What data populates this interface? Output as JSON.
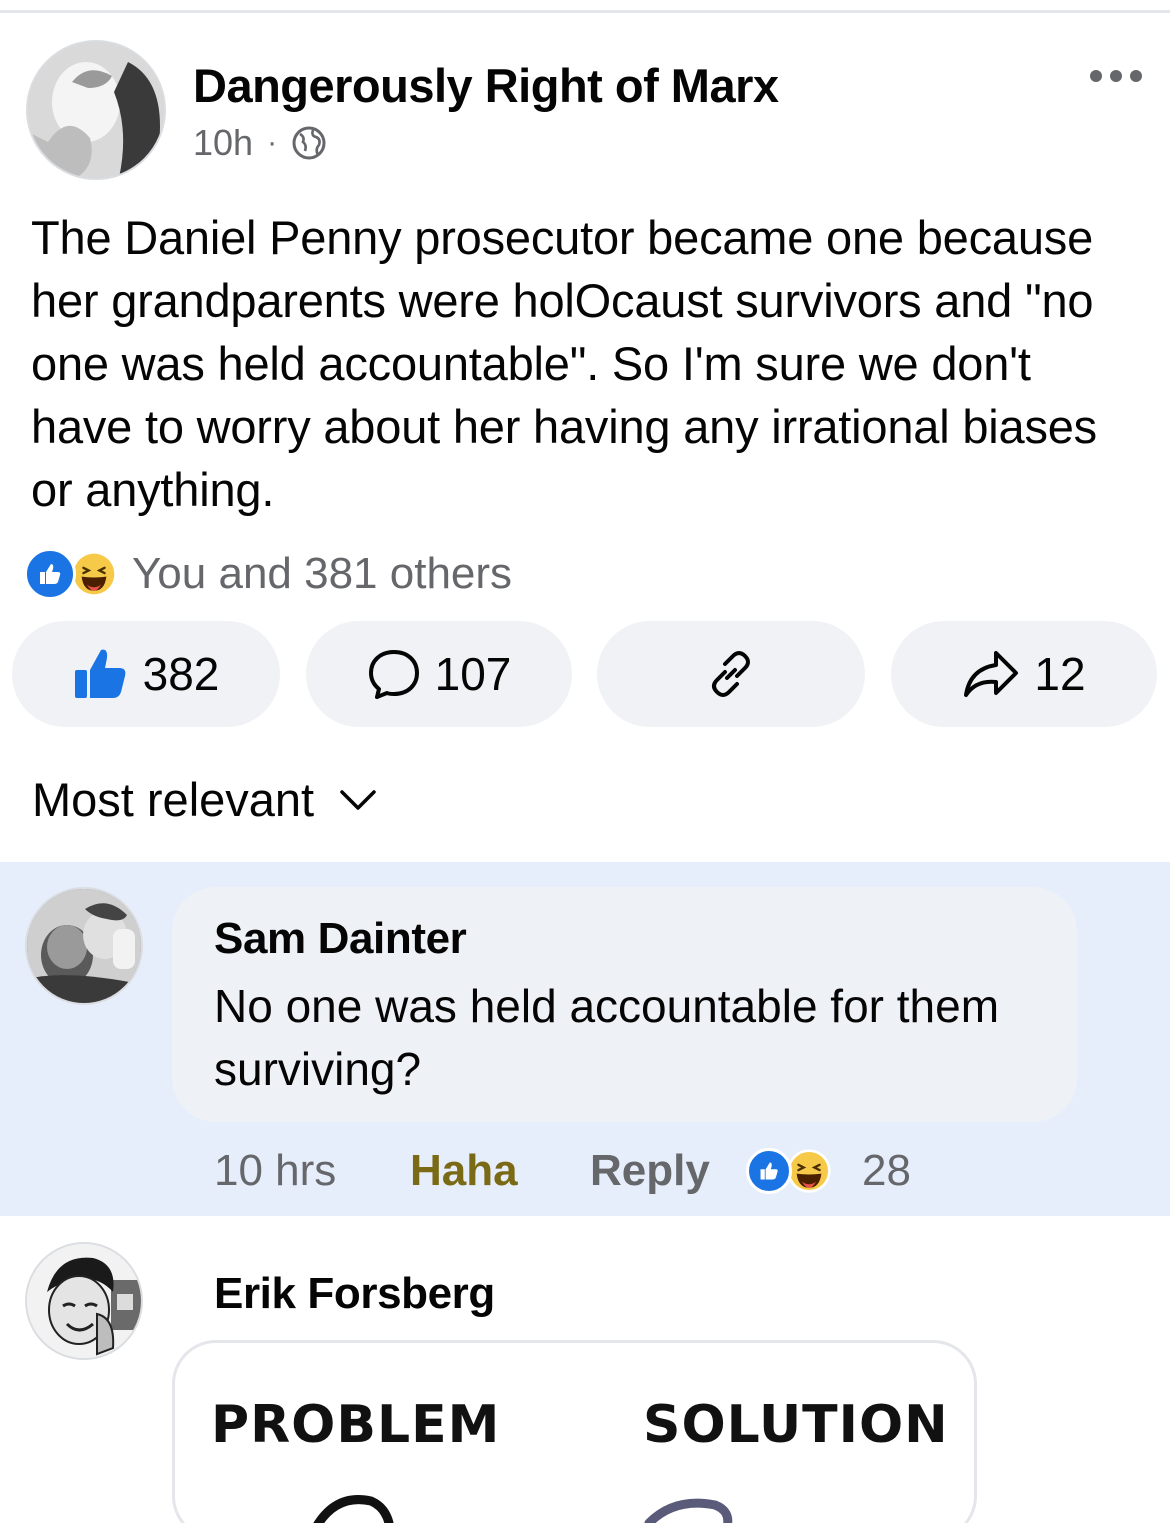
{
  "post": {
    "author": "Dangerously Right of Marx",
    "time": "10h",
    "separator": "·",
    "privacy_icon": "globe-icon",
    "more_icon": "more-options-icon",
    "text": "The Daniel Penny prosecutor became one because her grandparents were holOcaust survivors and \"no one was held accountable\".  So I'm sure we don't have to worry about her having any irrational biases or anything.",
    "reaction_summary": "You and 381 others",
    "reaction_icons": [
      "like-icon",
      "haha-icon"
    ]
  },
  "actions": {
    "like_count": "382",
    "comment_count": "107",
    "share_count": "12"
  },
  "sort": {
    "label": "Most relevant"
  },
  "comments": [
    {
      "author": "Sam Dainter",
      "text": "No one was held accountable for them surviving?",
      "time": "10 hrs",
      "reaction_label": "Haha",
      "reply_label": "Reply",
      "reaction_count": "28"
    },
    {
      "author": "Erik Forsberg",
      "image_labels": [
        "PROBLEM",
        "SOLUTION"
      ]
    }
  ],
  "colors": {
    "accent": "#1b74e4",
    "haha_label": "#7a6a16",
    "highlight_bg": "#e7eefb",
    "pill_bg": "#f0f2f5",
    "muted_text": "#65676b"
  }
}
